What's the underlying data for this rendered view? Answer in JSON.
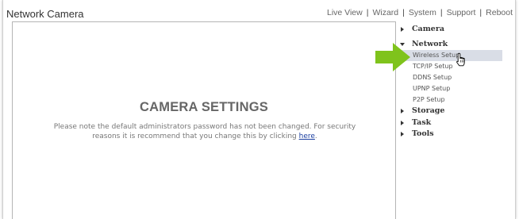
{
  "header": {
    "title": "Network Camera",
    "nav": {
      "live_view": "Live View",
      "wizard": "Wizard",
      "system": "System",
      "support": "Support",
      "reboot": "Reboot",
      "separator": "|"
    }
  },
  "main": {
    "heading": "CAMERA SETTINGS",
    "note_text": "Please note the default administrators password has not been changed. For security reasons it is recommend that you change this by clicking",
    "note_link": "here",
    "note_end": "."
  },
  "sidebar": {
    "camera": "Camera",
    "network": "Network",
    "network_items": [
      "Wireless Setup",
      "TCP/IP Setup",
      "DDNS Setup",
      "UPNP Setup",
      "P2P Setup"
    ],
    "storage": "Storage",
    "task": "Task",
    "tools": "Tools",
    "active_item": "Wireless Setup"
  },
  "colors": {
    "arrow": "#7fc31c",
    "active_bg": "#d9dde6",
    "link": "#1a3ea0"
  },
  "icons": {
    "arrow": "green-right-arrow-icon",
    "cursor": "hand-pointer-icon"
  }
}
